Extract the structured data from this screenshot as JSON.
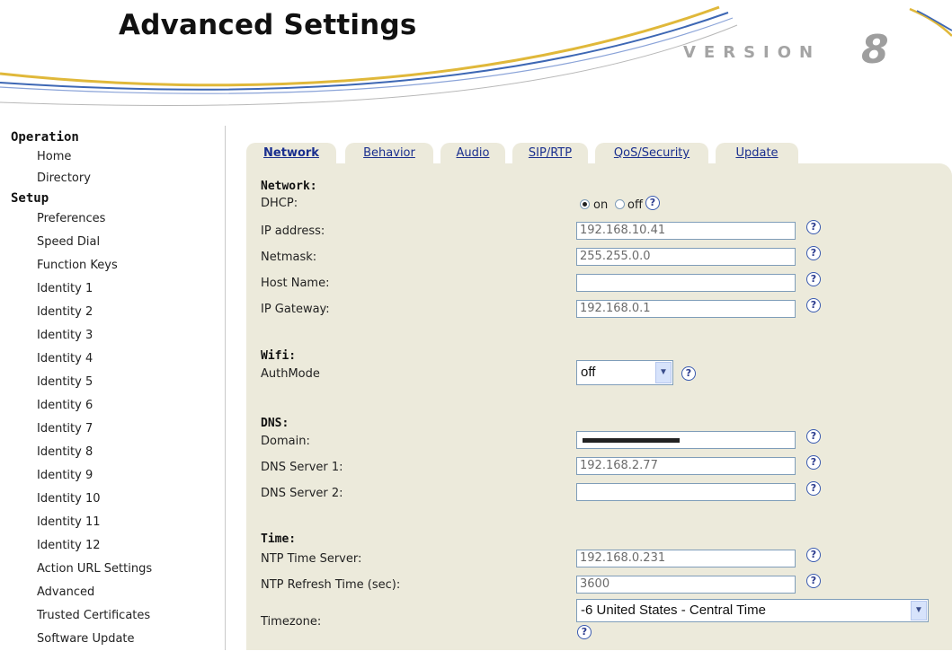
{
  "header": {
    "title": "Advanced Settings",
    "version_label": "VERSION",
    "version_number": "8"
  },
  "sidebar": {
    "sections": [
      {
        "label": "Operation",
        "items": [
          "Home",
          "Directory"
        ]
      },
      {
        "label": "Setup",
        "items": [
          "Preferences",
          "Speed Dial",
          "Function Keys",
          "Identity 1",
          "Identity 2",
          "Identity 3",
          "Identity 4",
          "Identity 5",
          "Identity 6",
          "Identity 7",
          "Identity 8",
          "Identity 9",
          "Identity 10",
          "Identity 11",
          "Identity 12",
          "Action URL Settings",
          "Advanced",
          "Trusted Certificates",
          "Software Update"
        ]
      }
    ]
  },
  "tabs": [
    "Network",
    "Behavior",
    "Audio",
    "SIP/RTP",
    "QoS/Security",
    "Update"
  ],
  "active_tab": "Network",
  "network": {
    "heading": "Network:",
    "dhcp_label": "DHCP:",
    "dhcp_on": "on",
    "dhcp_off": "off",
    "dhcp_value": "on",
    "ip_label": "IP address:",
    "ip_value": "192.168.10.41",
    "netmask_label": "Netmask:",
    "netmask_value": "255.255.0.0",
    "hostname_label": "Host Name:",
    "hostname_value": "",
    "gateway_label": "IP Gateway:",
    "gateway_value": "192.168.0.1"
  },
  "wifi": {
    "heading": "Wifi:",
    "authmode_label": "AuthMode",
    "authmode_value": "off"
  },
  "dns": {
    "heading": "DNS:",
    "domain_label": "Domain:",
    "domain_value": "",
    "server1_label": "DNS Server 1:",
    "server1_value": "192.168.2.77",
    "server2_label": "DNS Server 2:",
    "server2_value": ""
  },
  "time": {
    "heading": "Time:",
    "ntp_server_label": "NTP Time Server:",
    "ntp_server_value": "192.168.0.231",
    "ntp_refresh_label": "NTP Refresh Time (sec):",
    "ntp_refresh_value": "3600",
    "timezone_label": "Timezone:",
    "timezone_value": "-6 United States - Central Time"
  },
  "help_glyph": "?",
  "colors": {
    "panel_bg": "#eceadb",
    "link": "#1a2f8e",
    "swoosh_gold": "#e0b83a",
    "swoosh_blue": "#3d67b4"
  }
}
